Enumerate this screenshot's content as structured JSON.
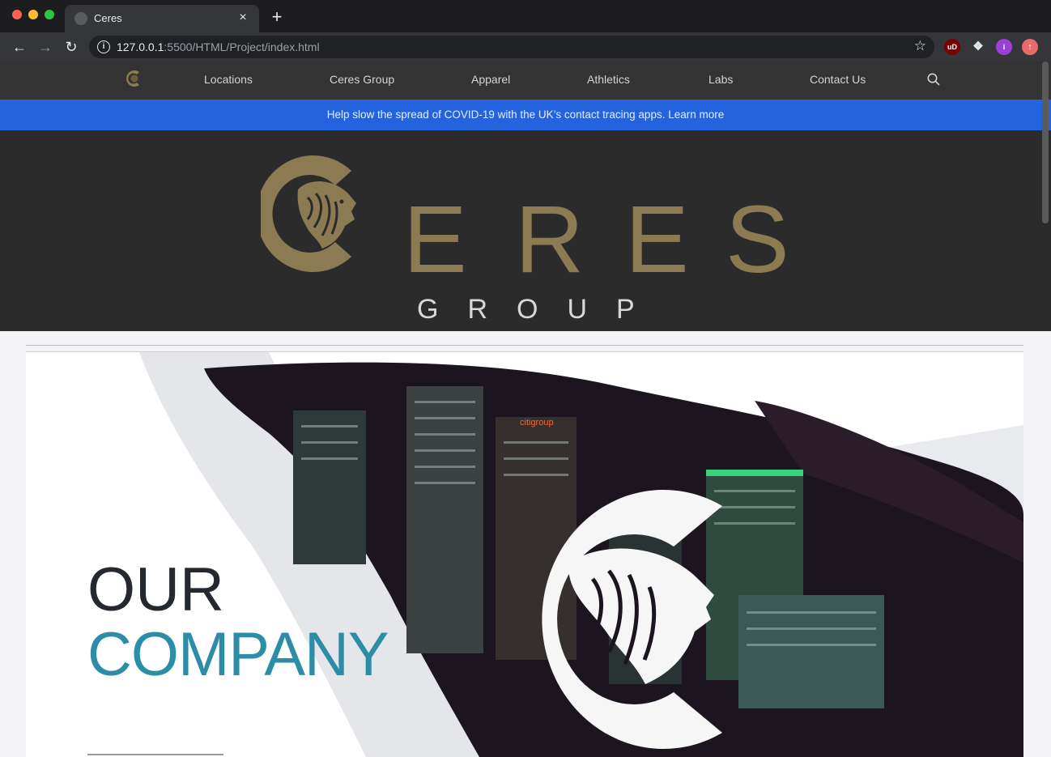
{
  "browser": {
    "tab_title": "Ceres",
    "tab_close": "×",
    "new_tab": "+",
    "url_host": "127.0.0.1",
    "url_rest": ":5500/HTML/Project/index.html",
    "ext_ublock": "uD",
    "ext_profile": "i"
  },
  "nav": {
    "links": [
      "Locations",
      "Ceres Group",
      "Apparel",
      "Athletics",
      "Labs",
      "Contact Us"
    ]
  },
  "banner": {
    "text": "Help slow the spread of COVID-19 with the UK’s contact tracing apps. Learn more"
  },
  "hero": {
    "letters": [
      "E",
      "R",
      "E",
      "S"
    ],
    "sub": "GROUP"
  },
  "feature": {
    "line1": "OUR",
    "line2": "COMPANY",
    "sign": "citigroup"
  },
  "colors": {
    "gold": "#8b7a52",
    "banner_blue": "#2563de",
    "teal": "#2d8da6"
  }
}
